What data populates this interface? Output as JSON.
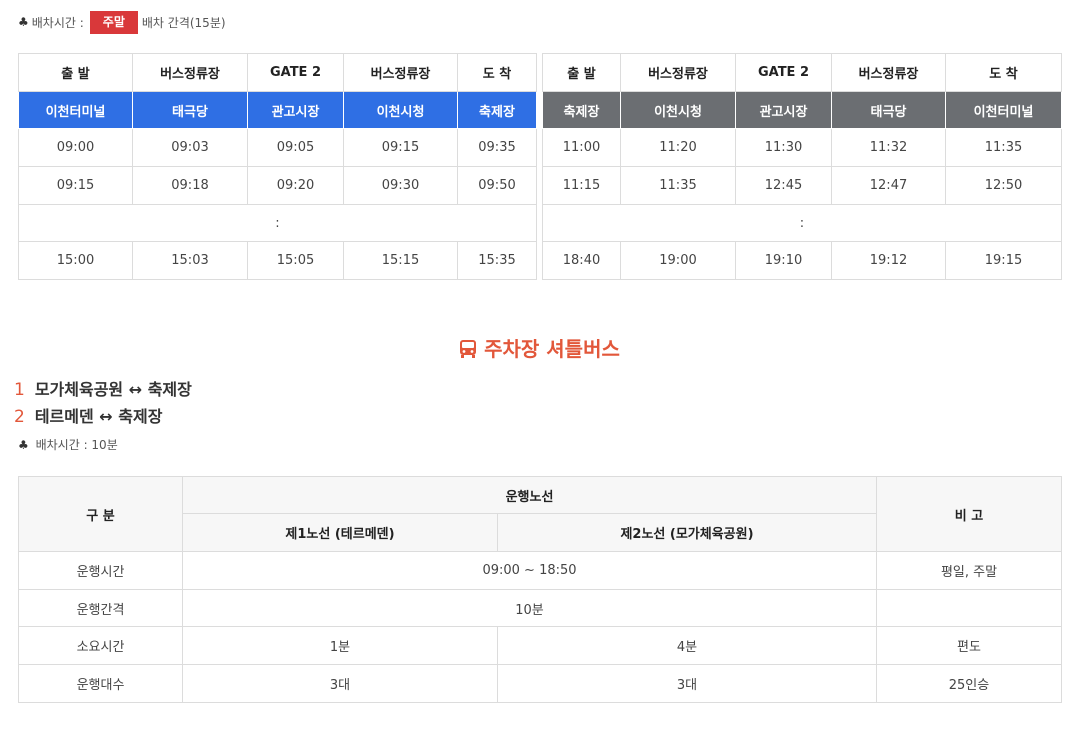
{
  "top_info": {
    "club_glyph": "♣",
    "label": "배차시간 :",
    "badge": "주말",
    "interval": "배차 간격(15분)"
  },
  "schedule_left": {
    "headers": [
      "출 발",
      "버스정류장",
      "GATE 2",
      "버스정류장",
      "도 착"
    ],
    "stops": [
      "이천터미널",
      "태극당",
      "관고시장",
      "이천시청",
      "축제장"
    ],
    "rows": [
      [
        "09:00",
        "09:03",
        "09:05",
        "09:15",
        "09:35"
      ],
      [
        "09:15",
        "09:18",
        "09:20",
        "09:30",
        "09:50"
      ]
    ],
    "gap": ":",
    "last_row": [
      "15:00",
      "15:03",
      "15:05",
      "15:15",
      "15:35"
    ]
  },
  "schedule_right": {
    "headers": [
      "출 발",
      "버스정류장",
      "GATE 2",
      "버스정류장",
      "도 착"
    ],
    "stops": [
      "축제장",
      "이천시청",
      "관고시장",
      "태극당",
      "이천터미널"
    ],
    "rows": [
      [
        "11:00",
        "11:20",
        "11:30",
        "11:32",
        "11:35"
      ],
      [
        "11:15",
        "11:35",
        "12:45",
        "12:47",
        "12:50"
      ]
    ],
    "gap": ":",
    "last_row": [
      "18:40",
      "19:00",
      "19:10",
      "19:12",
      "19:15"
    ]
  },
  "shuttle_section": {
    "title": "주차장 셔틀버스",
    "icon": "bus-icon",
    "routes": [
      {
        "num": "1",
        "label": "모가체육공원 ↔ 축제장"
      },
      {
        "num": "2",
        "label": "테르메덴 ↔ 축제장"
      }
    ],
    "interval": "배차시간 : 10분"
  },
  "shuttle_table": {
    "col_category": "구 분",
    "col_route_group": "운행노선",
    "col_route1": "제1노선 (테르메덴)",
    "col_route2": "제2노선 (모가체육공원)",
    "col_note": "비 고",
    "rows": [
      {
        "label": "운행시간",
        "merged": "09:00 ~ 18:50",
        "note": "평일, 주말"
      },
      {
        "label": "운행간격",
        "merged": "10분",
        "note": ""
      },
      {
        "label": "소요시간",
        "route1": "1분",
        "route2": "4분",
        "note": "편도"
      },
      {
        "label": "운행대수",
        "route1": "3대",
        "route2": "3대",
        "note": "25인승"
      }
    ]
  },
  "colors": {
    "blue_header": "#2f6fe4",
    "gray_header": "#6b6e72",
    "badge_red": "#d9383a",
    "accent_orange": "#e2573a"
  }
}
